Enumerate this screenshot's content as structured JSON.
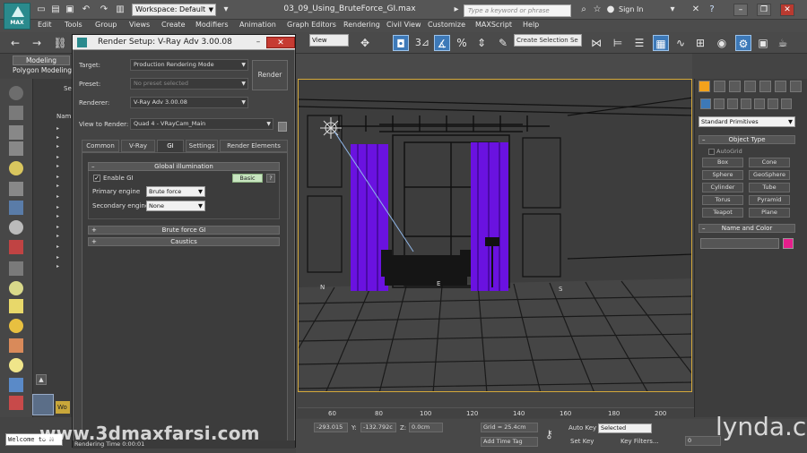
{
  "titlebar": {
    "logo_text": "MAX",
    "workspace": "Workspace: Default",
    "file_title": "03_09_Using_BruteForce_GI.max",
    "search_placeholder": "Type a keyword or phrase",
    "sign_in": "Sign In",
    "help_glyph": "?"
  },
  "menu": [
    "Edit",
    "Tools",
    "Group",
    "Views",
    "Create",
    "Modifiers",
    "Animation",
    "Graph Editors",
    "Rendering",
    "Civil View",
    "Customize",
    "MAXScript",
    "Help"
  ],
  "toolbar": {
    "view_dropdown": "View",
    "count_label": "3",
    "selection_set": "Create Selection Se"
  },
  "ribbon": {
    "tab_modeling": "Modeling",
    "tab_polygon": "Polygon Modeling"
  },
  "scene_explorer": {
    "head_s": "Se",
    "name_col": "Nam"
  },
  "render_setup": {
    "title": "Render Setup: V-Ray Adv 3.00.08",
    "target_label": "Target:",
    "target_value": "Production Rendering Mode",
    "preset_label": "Preset:",
    "preset_value": "No preset selected",
    "renderer_label": "Renderer:",
    "renderer_value": "V-Ray Adv 3.00.08",
    "view_label": "View to Render:",
    "view_value": "Quad 4 - VRayCam_Main",
    "render_button": "Render",
    "tabs": [
      "Common",
      "V-Ray",
      "GI",
      "Settings",
      "Render Elements"
    ],
    "active_tab": "GI",
    "gi_rollout_title": "Global illumination",
    "enable_gi_label": "Enable GI",
    "enable_gi_checked": "✓",
    "basic_button": "Basic",
    "help_button": "?",
    "primary_label": "Primary engine",
    "primary_value": "Brute force",
    "secondary_label": "Secondary engine",
    "secondary_value": "None",
    "bf_rollout_title": "Brute force GI",
    "caustics_title": "Caustics",
    "render_time": "Rendering Time  0:00:01"
  },
  "viewport": {
    "curtain_color": "#6a12e0",
    "floor_color": "#454545",
    "label_n": "N",
    "label_e": "E",
    "label_s": "S"
  },
  "command_panel": {
    "primitives_dropdown": "Standard Primitives",
    "object_type_title": "Object Type",
    "autogrid_label": "AutoGrid",
    "buttons": [
      "Box",
      "Cone",
      "Sphere",
      "GeoSphere",
      "Cylinder",
      "Tube",
      "Torus",
      "Pyramid",
      "Teapot",
      "Plane"
    ],
    "name_color_title": "Name and Color",
    "swatch_color": "#e51e8c"
  },
  "timeline": {
    "ticks": [
      "60",
      "80",
      "100",
      "120",
      "140",
      "160",
      "180",
      "200"
    ]
  },
  "status": {
    "x_value": "-293.015",
    "y_label": "Y:",
    "y_value": "-132.792c",
    "z_label": "Z:",
    "z_value": "0.0cm",
    "grid": "Grid = 25.4cm",
    "auto_key": "Auto Key",
    "selected": "Selected",
    "set_key": "Set Key",
    "key_filters": "Key Filters...",
    "add_time_tag": "Add Time Tag",
    "frame": "0"
  },
  "maxscript": {
    "welcome": "Welcome to M",
    "wo": "Wo"
  },
  "watermark": {
    "url": "www.3dmaxfarsi.com",
    "brand": "lynda.com"
  }
}
